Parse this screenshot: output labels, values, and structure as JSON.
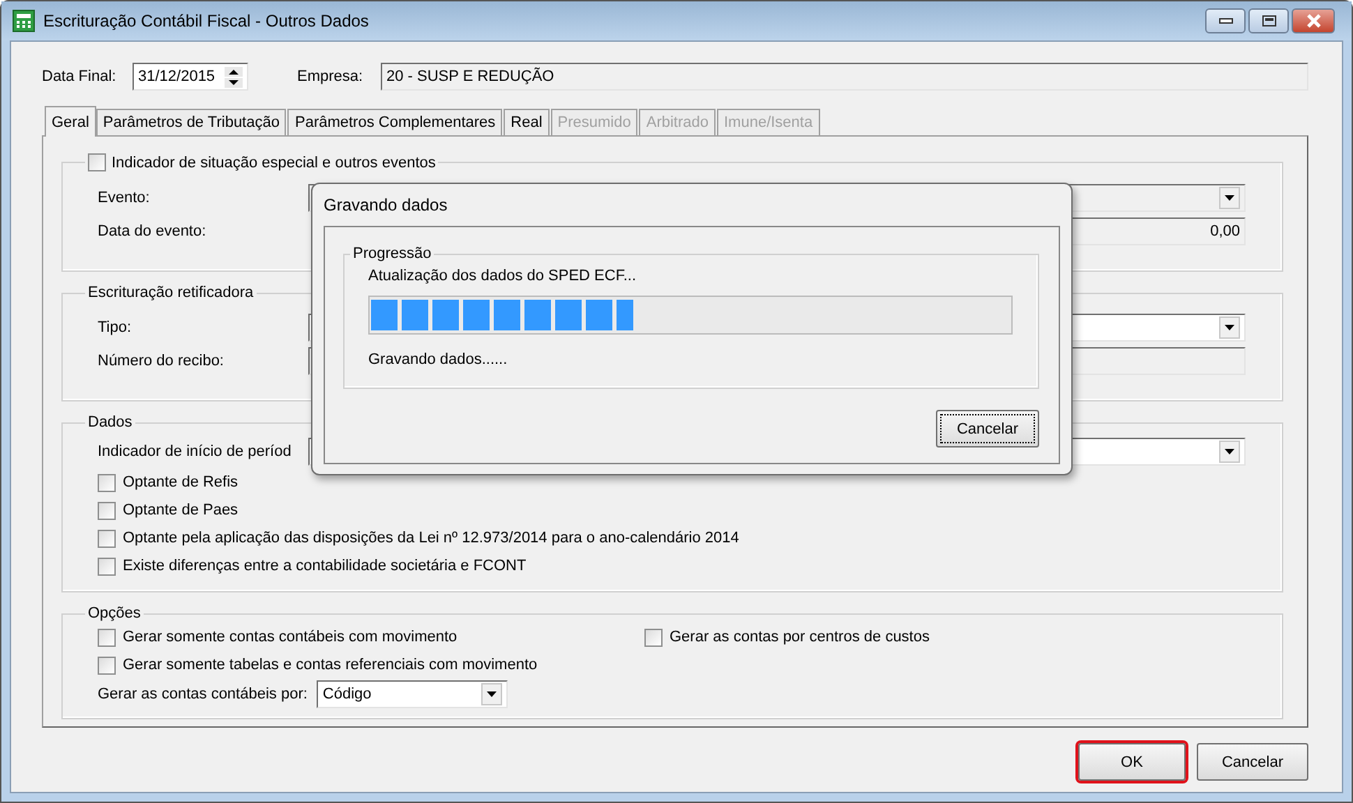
{
  "window": {
    "title": "Escrituração Contábil Fiscal - Outros Dados"
  },
  "header": {
    "date_label": "Data Final:",
    "date_value": "31/12/2015",
    "company_label": "Empresa:",
    "company_value": "20 - SUSP E REDUÇÃO"
  },
  "tabs": [
    {
      "label": "Geral",
      "selected": true,
      "disabled": false
    },
    {
      "label": "Parâmetros de Tributação",
      "selected": false,
      "disabled": false
    },
    {
      "label": "Parâmetros Complementares",
      "selected": false,
      "disabled": false
    },
    {
      "label": "Real",
      "selected": false,
      "disabled": false
    },
    {
      "label": "Presumido",
      "selected": false,
      "disabled": true
    },
    {
      "label": "Arbitrado",
      "selected": false,
      "disabled": true
    },
    {
      "label": "Imune/Isenta",
      "selected": false,
      "disabled": true
    }
  ],
  "groups": [
    {
      "kind": "check_title",
      "title": "Indicador de situação especial e outros eventos",
      "checked": false,
      "rows": [
        {
          "kind": "combo",
          "label": "Evento:",
          "disabled": true
        },
        {
          "kind": "value_field",
          "label": "Data do evento:",
          "value": "0,00"
        }
      ]
    },
    {
      "kind": "plain",
      "title": "Escrituração retificadora",
      "rows": [
        {
          "kind": "combo",
          "label": "Tipo:",
          "disabled": false
        },
        {
          "kind": "field",
          "label": "Número do recibo:",
          "disabled": true
        }
      ]
    },
    {
      "kind": "plain",
      "title": "Dados",
      "rows": [
        {
          "kind": "combo",
          "label": "Indicador de início de períod",
          "disabled": false
        },
        {
          "kind": "checkbox",
          "label": "Optante de Refis",
          "checked": false
        },
        {
          "kind": "checkbox",
          "label": "Optante de Paes",
          "checked": false
        },
        {
          "kind": "checkbox",
          "label": "Optante pela aplicação das disposições da Lei nº 12.973/2014 para o ano-calendário 2014",
          "checked": false
        },
        {
          "kind": "checkbox",
          "label": "Existe diferenças entre a contabilidade societária e FCONT",
          "checked": false
        }
      ]
    },
    {
      "kind": "two_column",
      "title": "Opções",
      "columns": [
        [
          {
            "kind": "checkbox",
            "label": "Gerar somente contas contábeis com movimento",
            "checked": false
          },
          {
            "kind": "checkbox",
            "label": "Gerar somente tabelas e contas referenciais com movimento",
            "checked": false
          },
          {
            "kind": "small_combo",
            "label": "Gerar as contas contábeis por:",
            "value": "Código"
          }
        ],
        [
          {
            "kind": "checkbox",
            "label": "Gerar as contas por centros de custos",
            "checked": false
          }
        ]
      ]
    }
  ],
  "buttons": [
    {
      "label": "OK",
      "highlighted": true
    },
    {
      "label": "Cancelar",
      "highlighted": false
    }
  ],
  "dialog": {
    "title": "Gravando dados",
    "group_title": "Progressão",
    "message": "Atualização dos dados do SPED ECF...",
    "level": 0.41,
    "status": "Gravando dados......",
    "button": "Cancelar"
  }
}
